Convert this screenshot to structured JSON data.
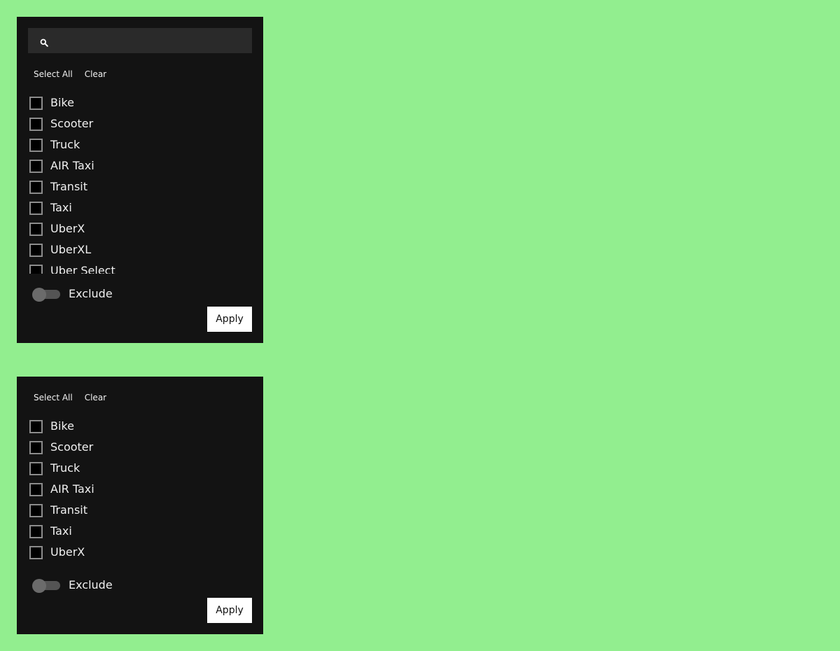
{
  "colors": {
    "background": "#92ee8f",
    "panel": "#131313",
    "search_field": "#2a2a2a",
    "checkbox_border": "#8c8c8c",
    "button": "#ffffff",
    "text": "#f0f0f0"
  },
  "panels": [
    {
      "search": {
        "icon": "search-icon",
        "value": "",
        "placeholder": ""
      },
      "actions": {
        "select_all": "Select All",
        "clear": "Clear"
      },
      "options": [
        {
          "label": "Bike",
          "checked": false
        },
        {
          "label": "Scooter",
          "checked": false
        },
        {
          "label": "Truck",
          "checked": false
        },
        {
          "label": "AIR Taxi",
          "checked": false
        },
        {
          "label": "Transit",
          "checked": false
        },
        {
          "label": "Taxi",
          "checked": false
        },
        {
          "label": "UberX",
          "checked": false
        },
        {
          "label": "UberXL",
          "checked": false
        },
        {
          "label": "Uber Select",
          "checked": false
        }
      ],
      "exclude": {
        "label": "Exclude",
        "on": false
      },
      "apply_label": "Apply"
    },
    {
      "actions": {
        "select_all": "Select All",
        "clear": "Clear"
      },
      "options": [
        {
          "label": "Bike",
          "checked": false
        },
        {
          "label": "Scooter",
          "checked": false
        },
        {
          "label": "Truck",
          "checked": false
        },
        {
          "label": "AIR Taxi",
          "checked": false
        },
        {
          "label": "Transit",
          "checked": false
        },
        {
          "label": "Taxi",
          "checked": false
        },
        {
          "label": "UberX",
          "checked": false
        }
      ],
      "exclude": {
        "label": "Exclude",
        "on": false
      },
      "apply_label": "Apply"
    }
  ]
}
